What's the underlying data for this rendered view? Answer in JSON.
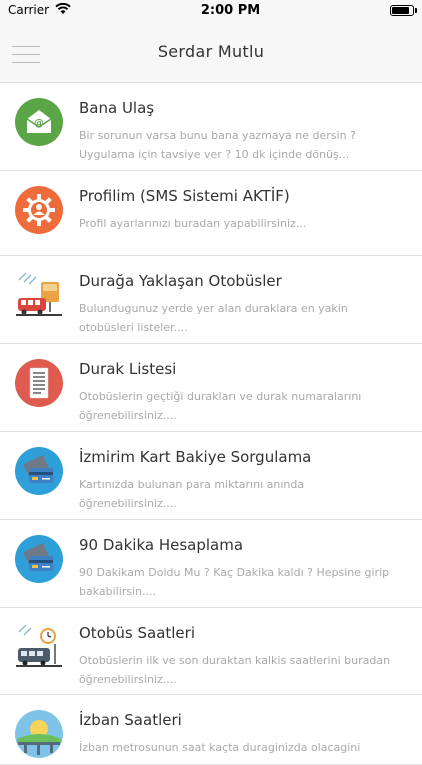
{
  "status_bar": {
    "carrier": "Carrier",
    "time": "2:00 PM",
    "battery_level": 0.9
  },
  "header": {
    "title": "Serdar Mutlu",
    "menu_icon": "hamburger-menu-icon"
  },
  "items": [
    {
      "icon": "envelope-at-icon",
      "color": "#5aa646",
      "title": "Bana Ulaş",
      "desc1": "Bir sorunun varsa bunu bana yazmaya ne dersin ?",
      "desc2": "Uygulama için tavsiye ver ? 10 dk içinde dönüş..."
    },
    {
      "icon": "gear-person-icon",
      "color": "#ee6b3b",
      "title": "Profilim (SMS Sistemi AKTİF)",
      "desc1": "Profil ayarlarınızı buradan yapabilirsiniz...",
      "desc2": ""
    },
    {
      "icon": "bus-stop-icon",
      "color": "#3aa3d8",
      "title": "Durağa Yaklaşan Otobüsler",
      "desc1": "Bulundugunuz yerde yer alan duraklara en yakin",
      "desc2": "otobüsleri listeler...."
    },
    {
      "icon": "document-list-icon",
      "color": "#e05b4f",
      "title": "Durak Listesi",
      "desc1": "Otobüslerin geçtiği durakları ve durak numaralarını",
      "desc2": "öğrenebilirsiniz...."
    },
    {
      "icon": "credit-card-icon",
      "color": "#2e9fd8",
      "title": "İzmirim Kart Bakiye Sorgulama",
      "desc1": "Kartınızda bulunan para miktarını anında",
      "desc2": "öğrenebilirsiniz...."
    },
    {
      "icon": "credit-card-icon",
      "color": "#2e9fd8",
      "title": "90 Dakika Hesaplama",
      "desc1": "90 Dakikam Doldu Mu ? Kaç Dakika kaldı ? Hepsine girip",
      "desc2": "bakabilirsin...."
    },
    {
      "icon": "bus-schedule-icon",
      "color": "#4b5b6b",
      "title": "Otobüs Saatleri",
      "desc1": "Otobüslerin ilk ve son duraktan kalkis saatlerini buradan",
      "desc2": "öğrenebilirsiniz...."
    },
    {
      "icon": "train-bridge-icon",
      "color": "#7fc4e8",
      "title": "İzban Saatleri",
      "desc1": "İzban metrosunun saat kaçta duraginizda olacagini",
      "desc2": ""
    }
  ]
}
